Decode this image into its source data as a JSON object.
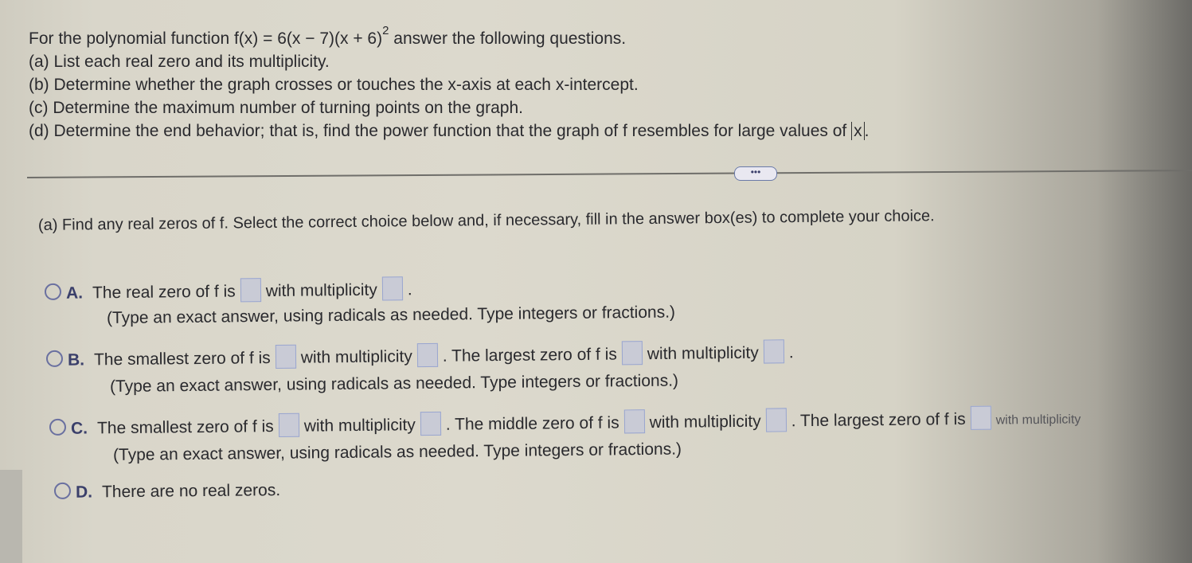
{
  "question": {
    "intro_prefix": "For the polynomial function f(x) = 6(x − 7)(x + 6)",
    "intro_exponent": "2",
    "intro_suffix": " answer the following questions.",
    "part_a": "(a) List each real zero and its multiplicity.",
    "part_b": "(b) Determine whether the graph crosses or touches the x-axis at each x-intercept.",
    "part_c": "(c) Determine the maximum number of turning points on the graph.",
    "part_d_prefix": "(d) Determine the end behavior; that is, find the power function that the graph of f resembles for large values of ",
    "part_d_abs": "x",
    "part_d_suffix": "."
  },
  "more_button": {
    "label": "•••"
  },
  "subquestion": {
    "prompt": "(a) Find any real zeros of f. Select the correct choice below and, if necessary, fill in the answer box(es) to complete your choice."
  },
  "choices": {
    "A": {
      "letter": "A.",
      "t1": "The real zero of f is",
      "t2": "with multiplicity",
      "t3": ".",
      "note": "(Type an exact answer, using radicals as needed. Type integers or fractions.)"
    },
    "B": {
      "letter": "B.",
      "t1": "The smallest zero of f is",
      "t2": "with multiplicity",
      "t3": ". The largest zero of f is",
      "t4": "with multiplicity",
      "t5": ".",
      "note": "(Type an exact answer, using radicals as needed. Type integers or fractions.)"
    },
    "C": {
      "letter": "C.",
      "t1": "The smallest zero of f is",
      "t2": "with multiplicity",
      "t3": ". The middle zero of f is",
      "t4": "with multiplicity",
      "t5": ". The largest zero of f is",
      "t6": "with multiplicity",
      "note": "(Type an exact answer, using radicals as needed. Type integers or fractions.)"
    },
    "D": {
      "letter": "D.",
      "t1": "There are no real zeros."
    }
  }
}
